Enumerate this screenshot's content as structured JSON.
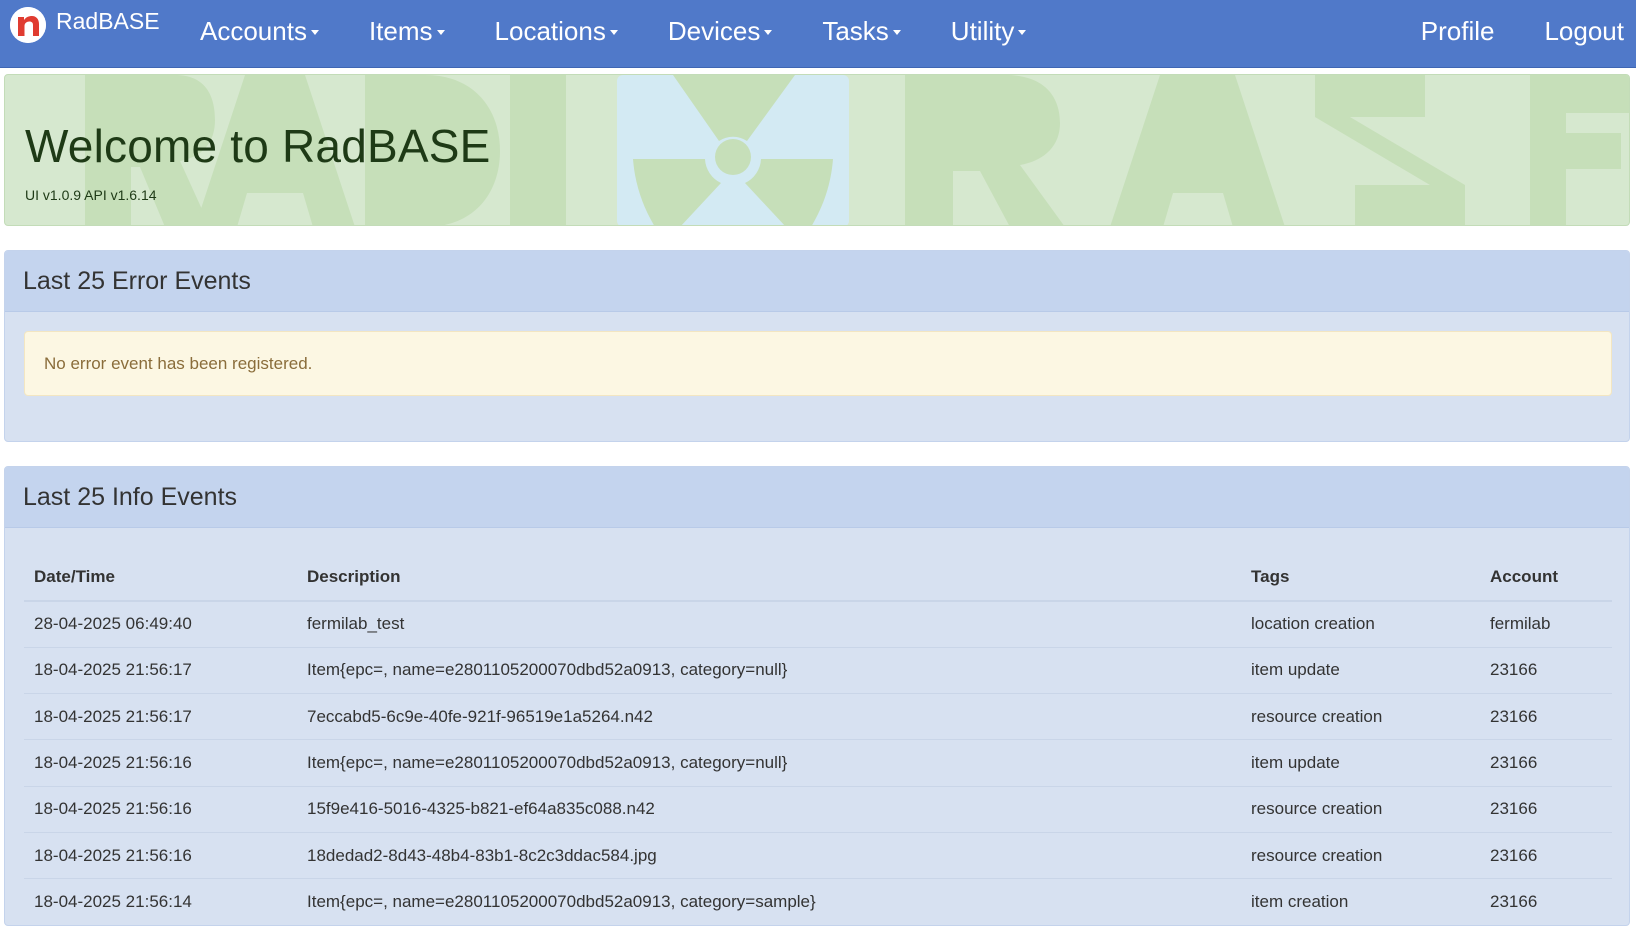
{
  "brand": {
    "name": "RadBASE",
    "icon": "rad-logo-icon",
    "colors": {
      "navbar": "#5079c9",
      "logo": "#e03c31"
    }
  },
  "nav": {
    "items": [
      {
        "label": "Accounts"
      },
      {
        "label": "Items"
      },
      {
        "label": "Locations"
      },
      {
        "label": "Devices"
      },
      {
        "label": "Tasks"
      },
      {
        "label": "Utility"
      }
    ],
    "right": {
      "profile": "Profile",
      "logout": "Logout"
    }
  },
  "jumbotron": {
    "title": "Welcome to RadBASE",
    "version": "UI v1.0.9 API v1.6.14",
    "background_text": "RADBASE",
    "background_icon": "radiation-icon"
  },
  "errors_panel": {
    "title": "Last 25 Error Events",
    "message": "No error event has been registered."
  },
  "info_panel": {
    "title": "Last 25 Info Events",
    "columns": {
      "datetime": "Date/Time",
      "description": "Description",
      "tags": "Tags",
      "account": "Account"
    },
    "rows": [
      {
        "datetime": "28-04-2025 06:49:40",
        "description": "fermilab_test",
        "tags": "location creation",
        "account": "fermilab"
      },
      {
        "datetime": "18-04-2025 21:56:17",
        "description": "Item{epc=, name=e2801105200070dbd52a0913, category=null}",
        "tags": "item update",
        "account": "23166"
      },
      {
        "datetime": "18-04-2025 21:56:17",
        "description": "7eccabd5-6c9e-40fe-921f-96519e1a5264.n42",
        "tags": "resource creation",
        "account": "23166"
      },
      {
        "datetime": "18-04-2025 21:56:16",
        "description": "Item{epc=, name=e2801105200070dbd52a0913, category=null}",
        "tags": "item update",
        "account": "23166"
      },
      {
        "datetime": "18-04-2025 21:56:16",
        "description": "15f9e416-5016-4325-b821-ef64a835c088.n42",
        "tags": "resource creation",
        "account": "23166"
      },
      {
        "datetime": "18-04-2025 21:56:16",
        "description": "18dedad2-8d43-48b4-83b1-8c2c3ddac584.jpg",
        "tags": "resource creation",
        "account": "23166"
      },
      {
        "datetime": "18-04-2025 21:56:14",
        "description": "Item{epc=, name=e2801105200070dbd52a0913, category=sample}",
        "tags": "item creation",
        "account": "23166"
      }
    ]
  }
}
